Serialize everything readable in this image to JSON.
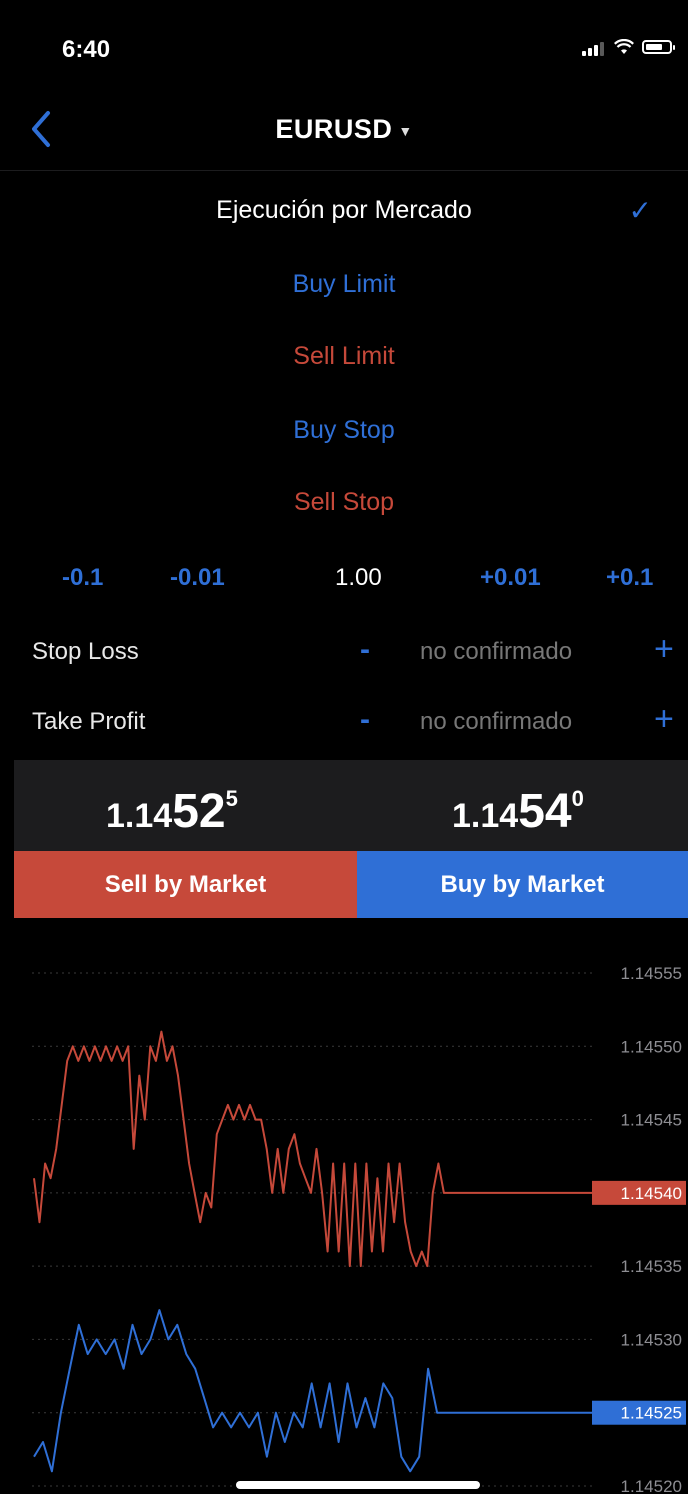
{
  "status_bar": {
    "time": "6:40"
  },
  "nav": {
    "symbol": "EURUSD",
    "caret": "▼"
  },
  "order_types": {
    "market_execution": "Ejecución por Mercado",
    "selected_mark": "✓",
    "buy_limit": "Buy Limit",
    "sell_limit": "Sell Limit",
    "buy_stop": "Buy Stop",
    "sell_stop": "Sell Stop"
  },
  "volume": {
    "minus_big": "-0.1",
    "minus_small": "-0.01",
    "value": "1.00",
    "plus_small": "+0.01",
    "plus_big": "+0.1"
  },
  "stop_loss": {
    "label": "Stop Loss",
    "minus": "-",
    "value": "no confirmado",
    "plus": "+"
  },
  "take_profit": {
    "label": "Take Profit",
    "minus": "-",
    "value": "no confirmado",
    "plus": "+"
  },
  "prices": {
    "sell": {
      "prefix": "1.14",
      "big": "52",
      "sup": "5"
    },
    "buy": {
      "prefix": "1.14",
      "big": "54",
      "sup": "0"
    }
  },
  "buttons": {
    "sell": "Sell by Market",
    "buy": "Buy by Market"
  },
  "colors": {
    "sell": "#c6493a",
    "buy": "#2f6fd6",
    "background": "#000000"
  },
  "chart_data": {
    "type": "line",
    "y_ticks": [
      "1.14555",
      "1.14550",
      "1.14545",
      "1.14540",
      "1.14535",
      "1.14530",
      "1.14525",
      "1.14520"
    ],
    "ylim": [
      1.1452,
      1.14555
    ],
    "grid": "dotted",
    "series": [
      {
        "role": "bid",
        "color": "#c6493a",
        "current_label": "1.14540",
        "values": [
          1.14541,
          1.14538,
          1.14542,
          1.14541,
          1.14543,
          1.14546,
          1.14549,
          1.1455,
          1.14549,
          1.1455,
          1.14549,
          1.1455,
          1.14549,
          1.1455,
          1.14549,
          1.1455,
          1.14549,
          1.1455,
          1.14543,
          1.14548,
          1.14545,
          1.1455,
          1.14549,
          1.14551,
          1.14549,
          1.1455,
          1.14548,
          1.14545,
          1.14542,
          1.1454,
          1.14538,
          1.1454,
          1.14539,
          1.14544,
          1.14545,
          1.14546,
          1.14545,
          1.14546,
          1.14545,
          1.14546,
          1.14545,
          1.14545,
          1.14543,
          1.1454,
          1.14543,
          1.1454,
          1.14543,
          1.14544,
          1.14542,
          1.14541,
          1.1454,
          1.14543,
          1.1454,
          1.14536,
          1.14542,
          1.14536,
          1.14542,
          1.14535,
          1.14542,
          1.14535,
          1.14542,
          1.14536,
          1.14541,
          1.14536,
          1.14542,
          1.14538,
          1.14542,
          1.14538,
          1.14536,
          1.14535,
          1.14536,
          1.14535,
          1.1454,
          1.14542,
          1.1454,
          1.1454,
          1.1454
        ]
      },
      {
        "role": "ask",
        "color": "#2f6fd6",
        "current_label": "1.14525",
        "values": [
          1.14522,
          1.14523,
          1.14521,
          1.14525,
          1.14528,
          1.14531,
          1.14529,
          1.1453,
          1.14529,
          1.1453,
          1.14528,
          1.14531,
          1.14529,
          1.1453,
          1.14532,
          1.1453,
          1.14531,
          1.14529,
          1.14528,
          1.14526,
          1.14524,
          1.14525,
          1.14524,
          1.14525,
          1.14524,
          1.14525,
          1.14522,
          1.14525,
          1.14523,
          1.14525,
          1.14524,
          1.14527,
          1.14524,
          1.14527,
          1.14523,
          1.14527,
          1.14524,
          1.14526,
          1.14524,
          1.14527,
          1.14526,
          1.14522,
          1.14521,
          1.14522,
          1.14528,
          1.14525,
          1.14525,
          1.14525
        ]
      }
    ]
  }
}
